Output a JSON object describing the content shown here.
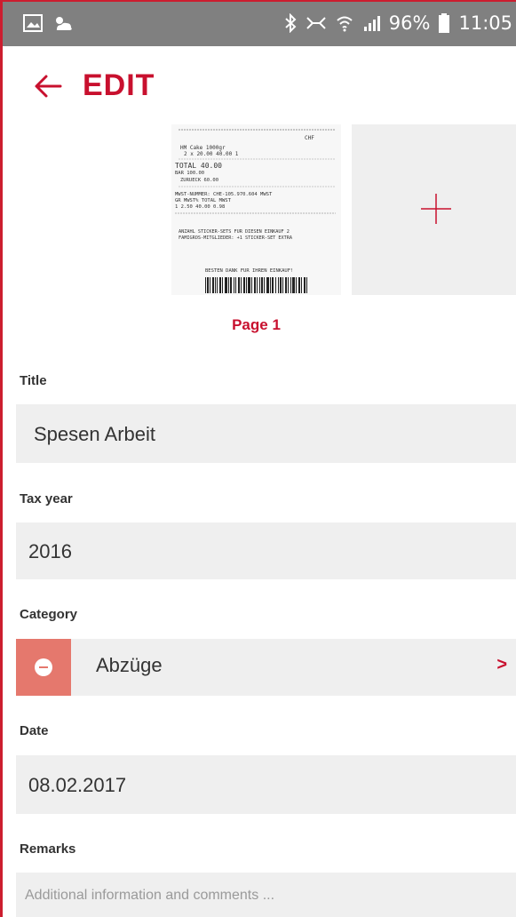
{
  "status_bar": {
    "battery": "96%",
    "time": "11:05"
  },
  "header": {
    "title": "EDIT"
  },
  "pages": {
    "items": [
      {
        "label": "Page 1",
        "receipt_lines": [
          "CHF",
          "HM Cake 1000gr",
          "2 x 20.00 40.00 1",
          "TOTAL 40.00",
          "BAR 100.00",
          "ZURUECK 60.00",
          "MWST-NUMMER: CHE-105.970.604 MWST",
          "GR MWST% TOTAL MWST",
          "1 2.50 40.00 0.98",
          "ANZAHL STICKER-SETS FUR DIESEN EINKAUF 2",
          "FAMIGROS-MITGLIEDER: +1 STICKER-SET EXTRA",
          "BESTEN DANK FUR IHREN EINKAUF!"
        ]
      }
    ]
  },
  "form": {
    "title_label": "Title",
    "title_value": "Spesen Arbeit",
    "tax_year_label": "Tax year",
    "tax_year_value": "2016",
    "category_label": "Category",
    "category_value": "Abzüge",
    "category_chevron": ">",
    "date_label": "Date",
    "date_value": "08.02.2017",
    "remarks_label": "Remarks",
    "remarks_placeholder": "Additional information and comments ..."
  },
  "colors": {
    "accent": "#c8102e",
    "status_bar": "#808080",
    "field_bg": "#efefef",
    "remove_bg": "#e5786d"
  },
  "icons": {
    "back": "arrow-left-icon",
    "add_page": "plus-icon",
    "remove_category": "minus-circle-icon",
    "chevron": "chevron-right-icon"
  }
}
